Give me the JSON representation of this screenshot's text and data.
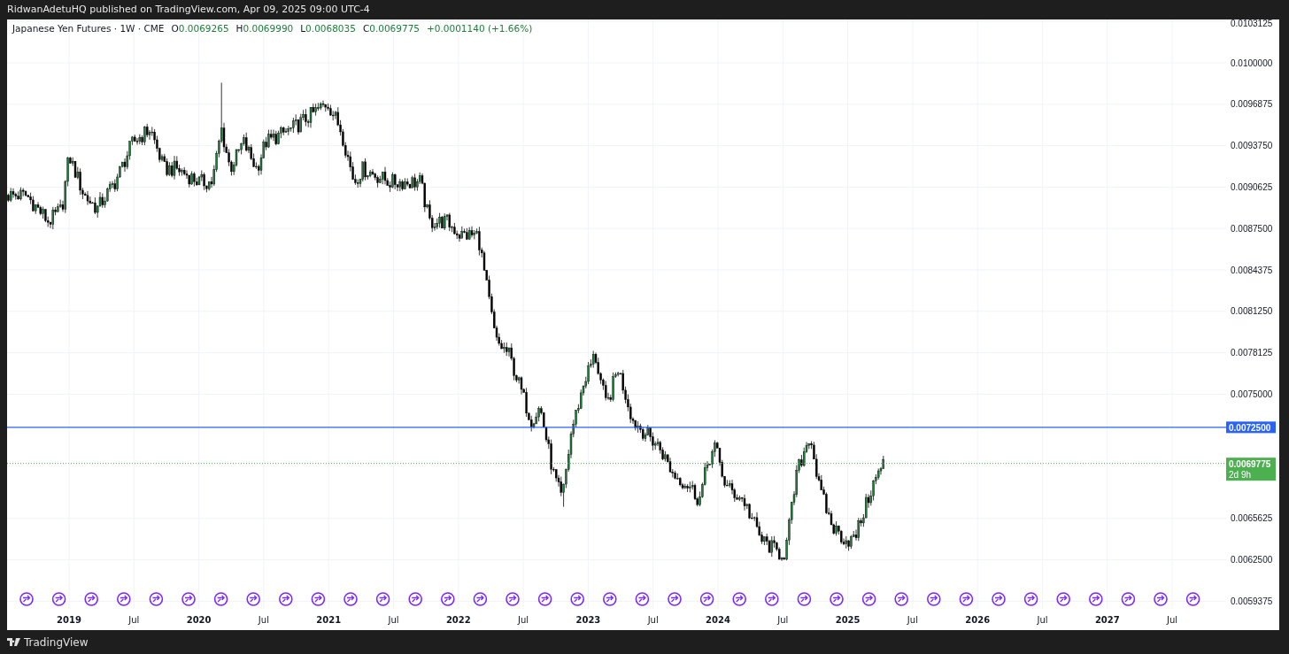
{
  "header": {
    "publisher": "RidwanAdetuHQ published on TradingView.com, Apr 09, 2025 09:00 UTC-4"
  },
  "legend": {
    "symbol": "Japanese Yen Futures · 1W · CME",
    "ohlc": [
      {
        "label": "O",
        "value": "0.0069265"
      },
      {
        "label": "H",
        "value": "0.0069990"
      },
      {
        "label": "L",
        "value": "0.0068035"
      },
      {
        "label": "C",
        "value": "0.0069775"
      }
    ],
    "change": "+0.0001140 (+1.66%)"
  },
  "price_axis": [
    "0.0103125",
    "0.0100000",
    "0.0096875",
    "0.0093750",
    "0.0090625",
    "0.0087500",
    "0.0084375",
    "0.0081250",
    "0.0078125",
    "0.0075000",
    "0.0065625",
    "0.0062500",
    "0.0059375"
  ],
  "time_axis": [
    {
      "label": "2019",
      "kind": "year"
    },
    {
      "label": "Jul",
      "kind": "month"
    },
    {
      "label": "2020",
      "kind": "year"
    },
    {
      "label": "Jul",
      "kind": "month"
    },
    {
      "label": "2021",
      "kind": "year"
    },
    {
      "label": "Jul",
      "kind": "month"
    },
    {
      "label": "2022",
      "kind": "year"
    },
    {
      "label": "Jul",
      "kind": "month"
    },
    {
      "label": "2023",
      "kind": "year"
    },
    {
      "label": "Jul",
      "kind": "month"
    },
    {
      "label": "2024",
      "kind": "year"
    },
    {
      "label": "Jul",
      "kind": "month"
    },
    {
      "label": "2025",
      "kind": "year"
    },
    {
      "label": "Jul",
      "kind": "month"
    },
    {
      "label": "2026",
      "kind": "year"
    },
    {
      "label": "Jul",
      "kind": "month"
    },
    {
      "label": "2027",
      "kind": "year"
    },
    {
      "label": "Jul",
      "kind": "month"
    }
  ],
  "horizontal_line": {
    "price": "0.0072500",
    "color": "#2962ff"
  },
  "last_price": {
    "price": "0.0069775",
    "countdown": "2d 9h",
    "color": "#4caf50"
  },
  "footer": {
    "brand": "TradingView"
  }
}
